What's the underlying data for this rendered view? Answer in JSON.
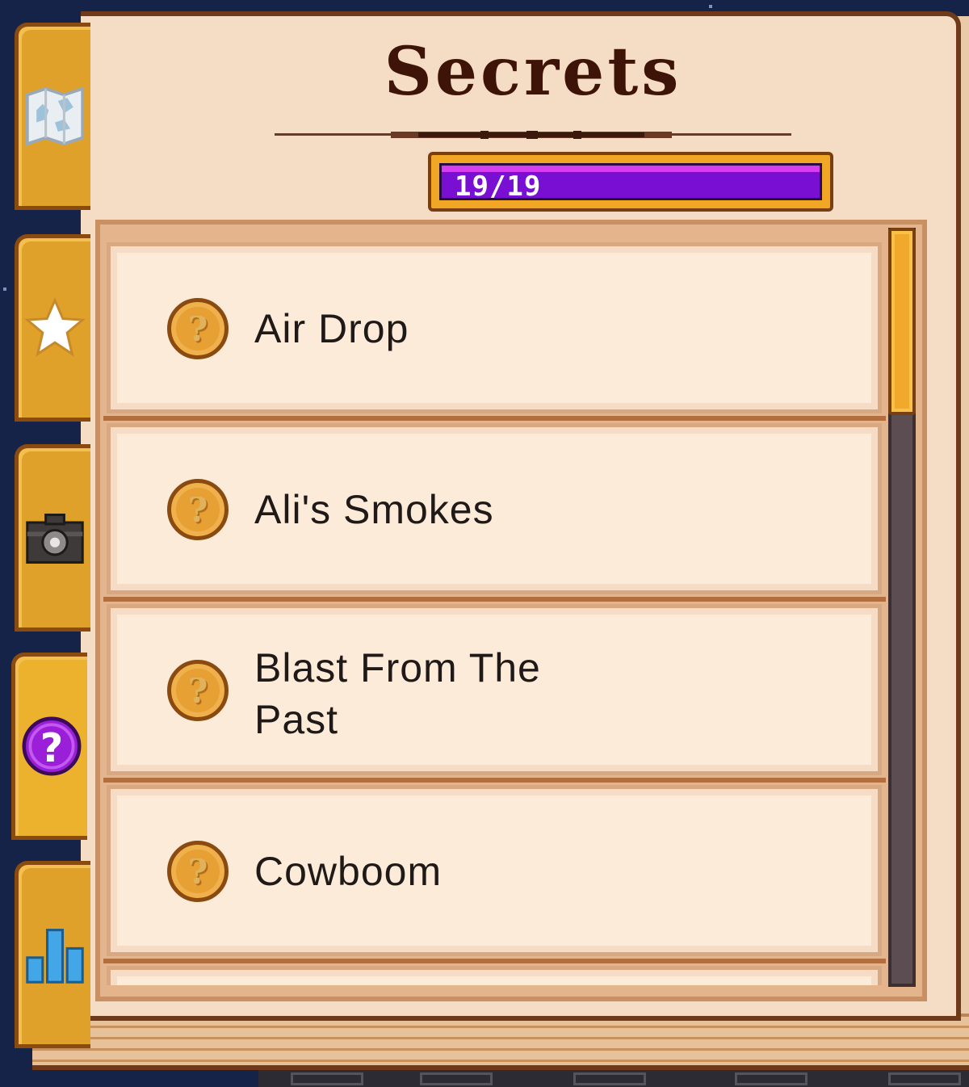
{
  "title": "Secrets",
  "progress": {
    "text": "19/19",
    "fraction": 1.0
  },
  "tabs": [
    {
      "name": "map-icon",
      "active": false
    },
    {
      "name": "star-icon",
      "active": false
    },
    {
      "name": "camera-icon",
      "active": false
    },
    {
      "name": "question-mark-icon",
      "active": true
    },
    {
      "name": "stats-icon",
      "active": false
    }
  ],
  "secrets": [
    {
      "label": "Air Drop",
      "icon": "unknown-coin-icon"
    },
    {
      "label": "Ali's Smokes",
      "icon": "unknown-coin-icon"
    },
    {
      "label_line1": "Blast From The",
      "label_line2": "Past",
      "icon": "unknown-coin-icon"
    },
    {
      "label": "Cowboom",
      "icon": "unknown-coin-icon"
    }
  ],
  "colors": {
    "progress_fill": "#7a0fd4",
    "active_tab_icon": "#9b1fd8",
    "coin": "#e6a033"
  }
}
